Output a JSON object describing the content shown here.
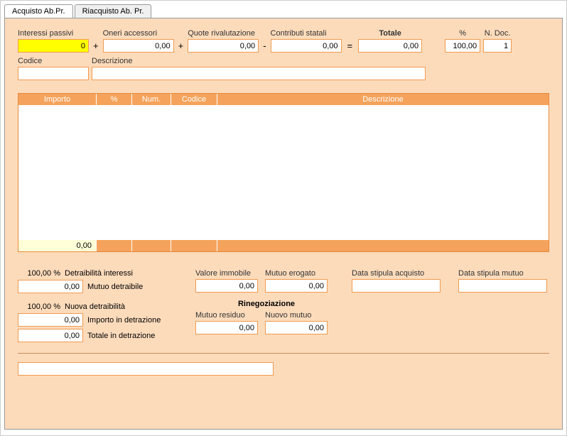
{
  "tabs": {
    "acquisto": "Acquisto Ab.Pr.",
    "riacquisto": "Riacquisto Ab. Pr."
  },
  "top": {
    "interessi_label": "Interessi passivi",
    "interessi_val": "0",
    "oneri_label": "Oneri accessori",
    "oneri_val": "0,00",
    "quote_label": "Quote rivalutazione",
    "quote_val": "0,00",
    "contributi_label": "Contributi statali",
    "contributi_val": "0,00",
    "totale_label": "Totale",
    "totale_val": "0,00",
    "perc_label": "%",
    "perc_val": "100,00",
    "ndoc_label": "N. Doc.",
    "ndoc_val": "1",
    "codice_label": "Codice",
    "codice_val": "",
    "descrizione_label": "Descrizione",
    "descrizione_val": ""
  },
  "table": {
    "headers": {
      "importo": "Importo",
      "perc": "%",
      "num": "Num.",
      "codice": "Codice",
      "descrizione": "Descrizione"
    },
    "footer_importo": "0,00"
  },
  "bottom": {
    "detra_perc": "100,00 %",
    "detra_label": "Detraibilità interessi",
    "mutuo_detra_val": "0,00",
    "mutuo_detra_label": "Mutuo detraibile",
    "nuova_perc": "100,00 %",
    "nuova_label": "Nuova detraibilità",
    "impdetr_val": "0,00",
    "impdetr_label": "Importo in detrazione",
    "totdetr_val": "0,00",
    "totdetr_label": "Totale in detrazione",
    "valore_imm_label": "Valore immobile",
    "valore_imm_val": "0,00",
    "mutuo_erog_label": "Mutuo erogato",
    "mutuo_erog_val": "0,00",
    "rineg_title": "Rinegoziazione",
    "mutuo_res_label": "Mutuo residuo",
    "mutuo_res_val": "0,00",
    "nuovo_mutuo_label": "Nuovo mutuo",
    "nuovo_mutuo_val": "0,00",
    "data_acq_label": "Data stipula acquisto",
    "data_acq_val": "",
    "data_mutuo_label": "Data stipula mutuo",
    "data_mutuo_val": "",
    "bottom_input_val": ""
  }
}
